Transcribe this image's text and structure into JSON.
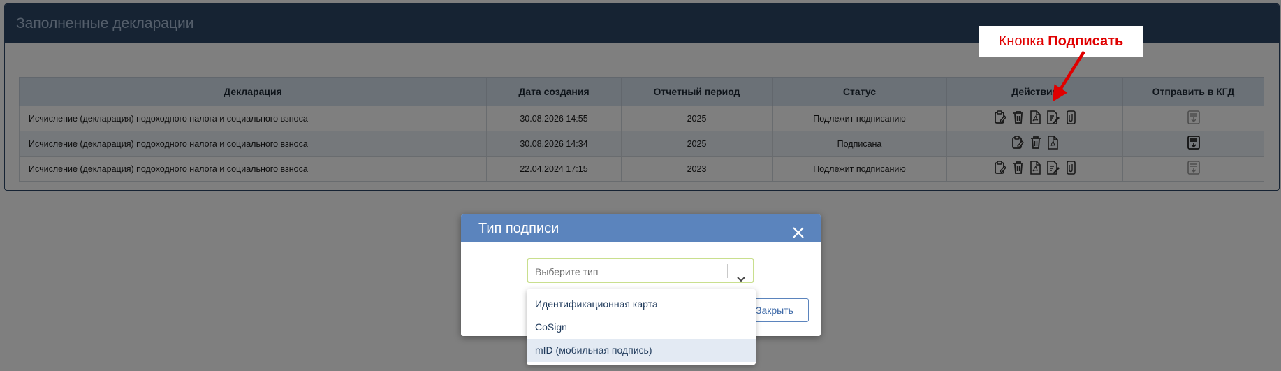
{
  "panel": {
    "title": "Заполненные декларации"
  },
  "table": {
    "headers": [
      "Декларация",
      "Дата создания",
      "Отчетный период",
      "Статус",
      "Действия",
      "Отправить в КГД"
    ],
    "rows": [
      {
        "declaration": "Исчисление (декларация) подоходного налога и социального взноса",
        "created": "30.08.2026 14:55",
        "period": "2025",
        "status": "Подлежит подписанию"
      },
      {
        "declaration": "Исчисление (декларация) подоходного налога и социального взноса",
        "created": "30.08.2026 14:34",
        "period": "2025",
        "status": "Подписана"
      },
      {
        "declaration": "Исчисление (декларация) подоходного налога и социального взноса",
        "created": "22.04.2024 17:15",
        "period": "2023",
        "status": "Подлежит подписанию"
      }
    ]
  },
  "callout": {
    "prefix": "Кнопка ",
    "bold": "Подписать"
  },
  "modal": {
    "title": "Тип подписи",
    "select_placeholder": "Выберите тип",
    "close_label": "Закрыть",
    "options": [
      "Идентификационная карта",
      "CoSign",
      "mID (мобильная подпись)"
    ]
  },
  "colors": {
    "header": "#2d4766",
    "modal_header": "#5b84bd",
    "annotation": "#e00000"
  }
}
